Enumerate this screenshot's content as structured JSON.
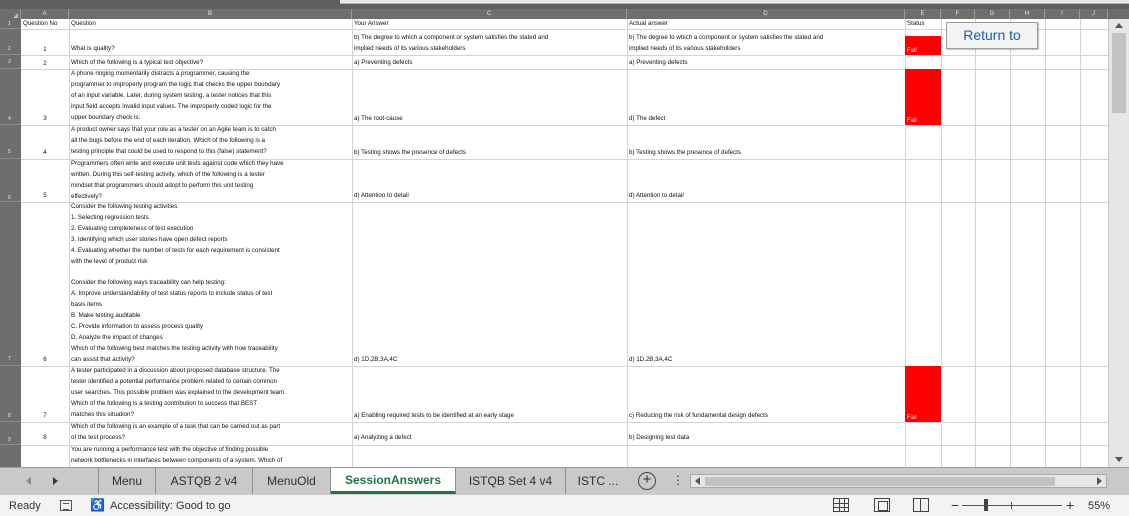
{
  "columns": [
    "A",
    "B",
    "C",
    "D",
    "E",
    "F",
    "G",
    "H",
    "I",
    "J"
  ],
  "header_row": {
    "a": "Question No",
    "b": "Question",
    "c": "Your Answer",
    "d": "Actual answer",
    "e": "Status"
  },
  "row_numbers": [
    "1",
    "2",
    "3",
    "4",
    "5",
    "6",
    "7",
    "8",
    "9"
  ],
  "rows": [
    {
      "num": "1",
      "question": "What is quality?",
      "your_answer": "b) The degree to which a component or system satisfies the stated and\nimplied needs of its various stakeholders",
      "actual_answer": "b) The degree to which a component or system satisfies the stated and\nimplied needs of its various stakeholders",
      "status": "Fail"
    },
    {
      "num": "2",
      "question": "Which of the following is a typical test objective?",
      "your_answer": "a) Preventing defects",
      "actual_answer": "a) Preventing defects",
      "status": ""
    },
    {
      "num": "3",
      "question": "A phone ringing momentarily distracts a programmer, causing the\nprogrammer to improperly program the logic that checks the upper boundary\nof an input variable. Later, during system testing, a tester notices that this\ninput field accepts invalid input values. The improperly coded logic for the\nupper boundary check is:",
      "your_answer": "a) The root-cause",
      "actual_answer": "d) The defect",
      "status": "Fail"
    },
    {
      "num": "4",
      "question": "A product owner says that your role as a tester on an Agile team is to catch\nall the bugs before the end of each iteration. Which of the following is a\ntesting principle that could be used to respond to this (false) statement?",
      "your_answer": "b) Testing shows the presence of defects",
      "actual_answer": "b) Testing shows the presence of defects",
      "status": ""
    },
    {
      "num": "5",
      "question": "Programmers often write and execute unit tests against code which they have\nwritten. During this self-testing activity, which of the following is a tester\nmindset that programmers should adopt to perform this unit testing\neffectively?",
      "your_answer": "d) Attention to detail",
      "actual_answer": "d) Attention to detail",
      "status": ""
    },
    {
      "num": "6",
      "question": "Consider the following testing activities:\n1. Selecting regression tests\n2. Evaluating completeness of test execution\n3. Identifying which user stories have open defect reports\n4. Evaluating whether the number of tests for each requirement is consistent\nwith the level of product risk\n\nConsider the following ways traceability can help testing:\nA. Improve understandability of test status reports to include status of test\nbasis items\nB. Make testing auditable\nC. Provide information to assess process quality\nD. Analyze the impact of changes\nWhich of the following best matches the testing activity with how traceability\ncan assist that activity?",
      "your_answer": "d) 1D,2B,3A,4C",
      "actual_answer": "d) 1D,2B,3A,4C",
      "status": ""
    },
    {
      "num": "7",
      "question": "A tester participated in a discussion about proposed database structure. The\ntester identified a potential performance problem related to certain common\nuser searches. This possible problem was explained to the development team.\nWhich of the following is a testing contribution to success that BEST\nmatches this situation?",
      "your_answer": "a) Enabling required tests to be identified at an early stage",
      "actual_answer": "c) Reducing the risk of fundamental design defects",
      "status": "Fail"
    },
    {
      "num": "8",
      "question": "Which of the following is an example of a task that can be carried out as part\nof the test process?",
      "your_answer": "a) Analyzing a defect",
      "actual_answer": "b) Designing test data",
      "status": ""
    },
    {
      "num": "",
      "question": "You are running a performance test with the objective of finding possible\nnetwork bottlenecks in interfaces between components of a system. Which of",
      "your_answer": "",
      "actual_answer": "",
      "status": ""
    }
  ],
  "return_button": "Return to",
  "sheet_tabs": [
    {
      "label": "Menu",
      "active": false
    },
    {
      "label": "ASTQB 2 v4",
      "active": false
    },
    {
      "label": "MenuOld",
      "active": false
    },
    {
      "label": "SessionAnswers",
      "active": true
    },
    {
      "label": "ISTQB Set 4 v4",
      "active": false
    },
    {
      "label": "ISTC ...",
      "active": false
    }
  ],
  "status_bar": {
    "ready": "Ready",
    "accessibility": "Accessibility: Good to go",
    "zoom": "55%"
  },
  "colors": {
    "fail_fill": "#ff0000",
    "active_tab": "#217346",
    "button_text": "#1f5fa8"
  }
}
